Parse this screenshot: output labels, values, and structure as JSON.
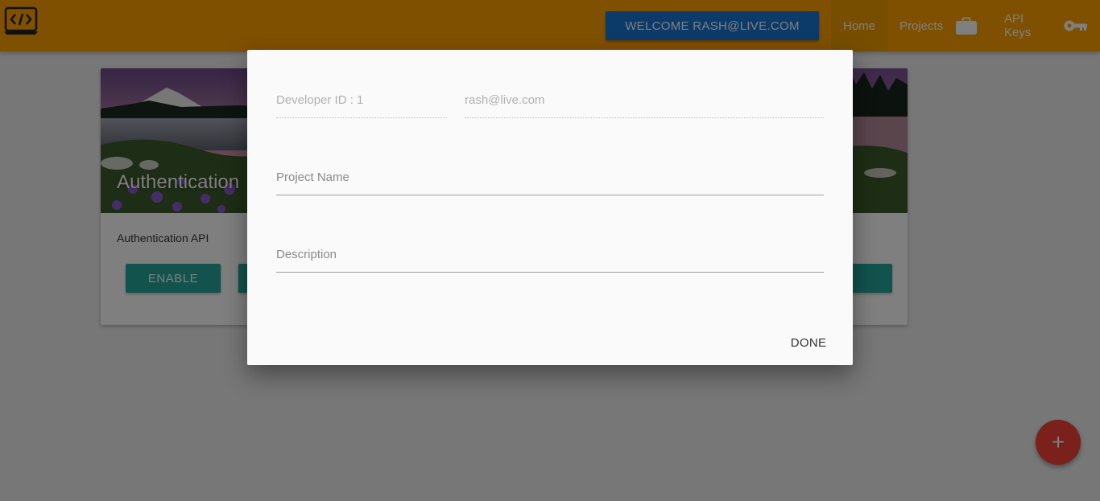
{
  "navbar": {
    "welcome_label": "WELCOME RASH@LIVE.COM",
    "items": [
      {
        "label": "Home",
        "icon": ""
      },
      {
        "label": "Projects",
        "icon": "briefcase-icon"
      },
      {
        "label": "API Keys",
        "icon": "key-icon"
      }
    ],
    "logo_icon": "code-laptop-icon"
  },
  "cards": [
    {
      "title": "Authentication",
      "text": "Authentication API",
      "buttons": [
        "ENABLE",
        ""
      ]
    },
    {
      "title": "",
      "text": "",
      "buttons": [
        ""
      ]
    }
  ],
  "fab": {
    "label": "+"
  },
  "dialog": {
    "developer_id": "Developer ID : 1",
    "email": "rash@live.com",
    "project_name_placeholder": "Project Name",
    "description_placeholder": "Description",
    "done_label": "DONE"
  },
  "colors": {
    "navbar": "#ffa000",
    "welcome_button": "#1976d2",
    "card_button": "#26a69a",
    "fab": "#f44336"
  }
}
